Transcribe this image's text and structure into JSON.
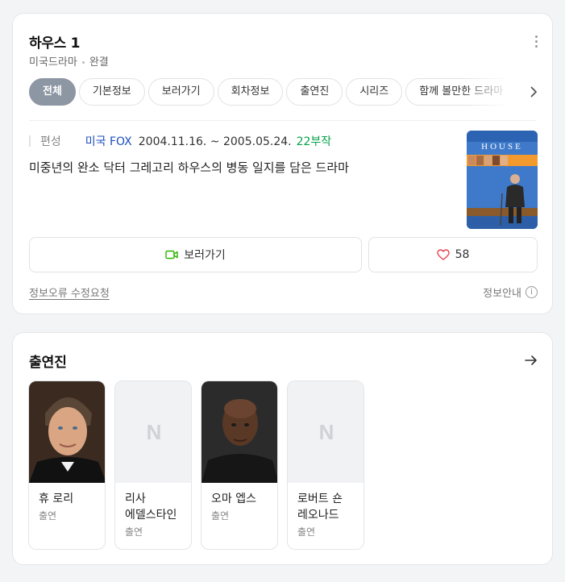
{
  "drama": {
    "title": "하우스 1",
    "category": "미국드라마",
    "status": "완결"
  },
  "tabs": [
    {
      "label": "전체",
      "active": true
    },
    {
      "label": "기본정보"
    },
    {
      "label": "보러가기"
    },
    {
      "label": "회차정보"
    },
    {
      "label": "출연진"
    },
    {
      "label": "시리즈"
    },
    {
      "label": "함께 볼만한 드라마"
    }
  ],
  "info": {
    "label": "편성",
    "network": "미국 FOX",
    "period": "2004.11.16. ~ 2005.05.24.",
    "episodes": "22부작",
    "description": "미중년의 완소 닥터 그레고리 하우스의 병동 일지를 담은 드라마",
    "poster_title": "HOUSE"
  },
  "actions": {
    "watch_label": "보러가기",
    "like_count": "58",
    "error_report": "정보오류 수정요청",
    "info_guide": "정보안내"
  },
  "cast": {
    "title": "출연진",
    "placeholder_logo": "N",
    "members": [
      {
        "name": "휴 로리",
        "role": "출연"
      },
      {
        "name": "리사 에델스타인",
        "role": "출연"
      },
      {
        "name": "오마 엡스",
        "role": "출연"
      },
      {
        "name": "로버트 숀 레오나드",
        "role": "출연"
      }
    ]
  },
  "colors": {
    "tab_active": "#8d96a3",
    "network": "#1d4fbf",
    "episodes": "#06a34a",
    "watch_icon": "#2db400",
    "heart": "#e8424f"
  }
}
